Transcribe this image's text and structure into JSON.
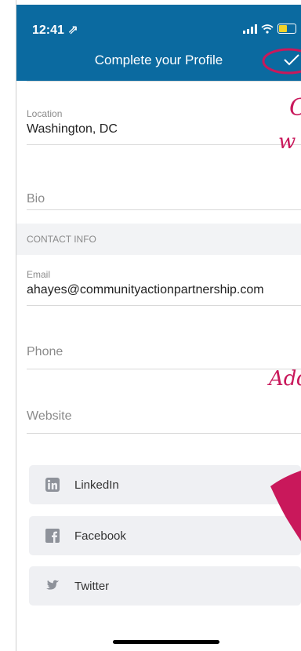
{
  "status_bar": {
    "time": "12:41 ⇗"
  },
  "header": {
    "title": "Complete your Profile"
  },
  "fields": {
    "location": {
      "label": "Location",
      "value": "Washington, DC"
    },
    "bio": {
      "placeholder": "Bio"
    },
    "email": {
      "label": "Email",
      "value": "ahayes@communityactionpartnership.com"
    },
    "phone": {
      "placeholder": "Phone"
    },
    "website": {
      "placeholder": "Website"
    }
  },
  "sections": {
    "contact_info": "CONTACT INFO"
  },
  "social": [
    {
      "label": "LinkedIn",
      "icon": "linkedin-icon"
    },
    {
      "label": "Facebook",
      "icon": "facebook-icon"
    },
    {
      "label": "Twitter",
      "icon": "twitter-icon"
    }
  ],
  "annotations": {
    "top": "C",
    "middle": "w",
    "lower": "Add"
  },
  "colors": {
    "header": "#0b6aa0",
    "annotation": "#c9185b",
    "social_bg": "#eff0f3",
    "section_bg": "#f2f3f5"
  }
}
